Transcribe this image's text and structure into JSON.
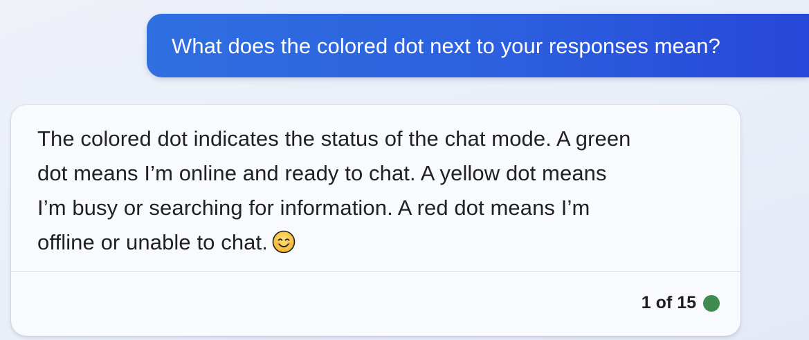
{
  "conversation": {
    "user_message": "What does the colored dot next to your responses mean?",
    "bot_message": {
      "lines": [
        "The colored dot indicates the status of the chat mode. A green",
        "dot means I’m online and ready to chat. A yellow dot means",
        "I’m busy or searching for information. A red dot means I’m",
        "offline or unable to chat."
      ],
      "emoji": "smiling-face-icon"
    },
    "response_counter": "1 of 15",
    "status_dot_color": "#3f8a4c"
  },
  "theme": {
    "user_bubble_gradient": [
      "#2f6fe0",
      "#2747d8"
    ],
    "background": "#eef1f8",
    "card_background": "#f9fafd"
  }
}
